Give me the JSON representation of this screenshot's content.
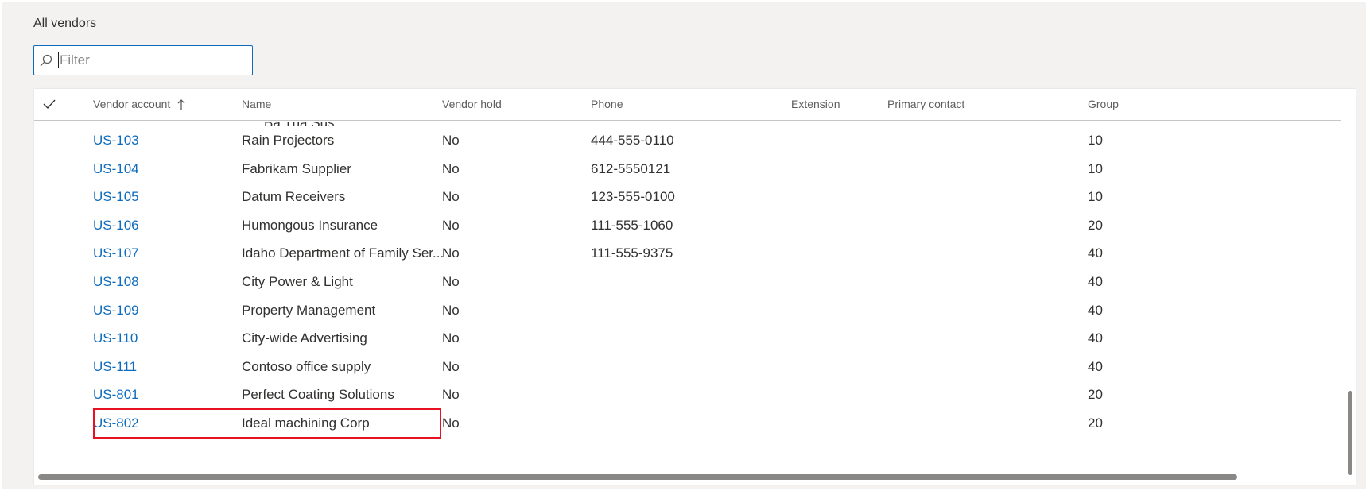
{
  "page": {
    "title": "All vendors"
  },
  "filter": {
    "placeholder": "Filter",
    "value": "",
    "icon": "search-icon"
  },
  "grid": {
    "columns": [
      {
        "key": "select",
        "label": "",
        "icon": "checkmark-icon"
      },
      {
        "key": "account",
        "label": "Vendor account",
        "sort": "ascending",
        "sort_icon": "arrow-up-icon"
      },
      {
        "key": "name",
        "label": "Name"
      },
      {
        "key": "hold",
        "label": "Vendor hold"
      },
      {
        "key": "phone",
        "label": "Phone"
      },
      {
        "key": "extension",
        "label": "Extension"
      },
      {
        "key": "contact",
        "label": "Primary contact"
      },
      {
        "key": "group",
        "label": "Group"
      }
    ],
    "rows": [
      {
        "account": "US-103",
        "name": "Rain Projectors",
        "hold": "No",
        "phone": "444-555-0110",
        "extension": "",
        "contact": "",
        "group": "10"
      },
      {
        "account": "US-104",
        "name": "Fabrikam Supplier",
        "hold": "No",
        "phone": "612-5550121",
        "extension": "",
        "contact": "",
        "group": "10"
      },
      {
        "account": "US-105",
        "name": "Datum Receivers",
        "hold": "No",
        "phone": "123-555-0100",
        "extension": "",
        "contact": "",
        "group": "10"
      },
      {
        "account": "US-106",
        "name": "Humongous Insurance",
        "hold": "No",
        "phone": "111-555-1060",
        "extension": "",
        "contact": "",
        "group": "20"
      },
      {
        "account": "US-107",
        "name": "Idaho Department of Family Ser...",
        "hold": "No",
        "phone": "111-555-9375",
        "extension": "",
        "contact": "",
        "group": "40"
      },
      {
        "account": "US-108",
        "name": "City Power & Light",
        "hold": "No",
        "phone": "",
        "extension": "",
        "contact": "",
        "group": "40"
      },
      {
        "account": "US-109",
        "name": "Property Management",
        "hold": "No",
        "phone": "",
        "extension": "",
        "contact": "",
        "group": "40"
      },
      {
        "account": "US-110",
        "name": "City-wide Advertising",
        "hold": "No",
        "phone": "",
        "extension": "",
        "contact": "",
        "group": "40"
      },
      {
        "account": "US-111",
        "name": "Contoso office supply",
        "hold": "No",
        "phone": "",
        "extension": "",
        "contact": "",
        "group": "40"
      },
      {
        "account": "US-801",
        "name": "Perfect Coating Solutions",
        "hold": "No",
        "phone": "",
        "extension": "",
        "contact": "",
        "group": "20",
        "highlighted": true
      },
      {
        "account": "US-802",
        "name": "Ideal machining Corp",
        "hold": "No",
        "phone": "",
        "extension": "",
        "contact": "",
        "group": "20"
      }
    ]
  },
  "colors": {
    "accent": "#0f6cbd",
    "highlight": "#e81123",
    "text": "#323130",
    "header_text": "#605e5c"
  }
}
